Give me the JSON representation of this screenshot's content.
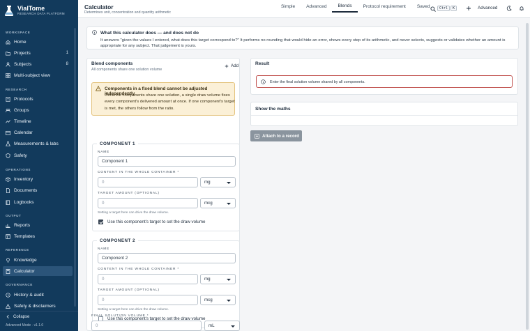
{
  "brand": {
    "name": "VialTome",
    "tagline": "RESEARCH DATA PLATFORM"
  },
  "sidebar": {
    "sections": {
      "workspace": "WORKSPACE",
      "research": "RESEARCH",
      "operations": "OPERATIONS",
      "output": "OUTPUT",
      "reference": "REFERENCE",
      "governance": "GOVERNANCE"
    },
    "items": [
      {
        "label": "Home",
        "icon": "home-icon"
      },
      {
        "label": "Projects",
        "icon": "folder-icon",
        "count": "1"
      },
      {
        "label": "Subjects",
        "icon": "subjects-icon",
        "count": "8"
      },
      {
        "label": "Multi-subject view",
        "icon": "grid-icon"
      },
      {
        "label": "Protocols",
        "icon": "protocol-icon"
      },
      {
        "label": "Groups",
        "icon": "groups-icon"
      },
      {
        "label": "Timeline",
        "icon": "timeline-icon"
      },
      {
        "label": "Calendar",
        "icon": "calendar-icon"
      },
      {
        "label": "Measurements & labs",
        "icon": "flask-icon"
      },
      {
        "label": "Safety",
        "icon": "shield-icon"
      },
      {
        "label": "Inventory",
        "icon": "box-icon"
      },
      {
        "label": "Documents",
        "icon": "document-icon"
      },
      {
        "label": "Logbooks",
        "icon": "book-icon"
      },
      {
        "label": "Reports",
        "icon": "chart-icon"
      },
      {
        "label": "Templates",
        "icon": "template-icon"
      },
      {
        "label": "Knowledge",
        "icon": "bulb-icon"
      },
      {
        "label": "Calculator",
        "icon": "calculator-icon"
      },
      {
        "label": "History & audit",
        "icon": "history-icon"
      },
      {
        "label": "Safety & disclaimers",
        "icon": "alert-icon"
      }
    ],
    "collapse_label": "Collapse",
    "version": "Advanced Mode · v1.1.0"
  },
  "header": {
    "title": "Calculator",
    "subtitle": "Determines unit, concentration and quantity arithmetic",
    "tabs": [
      "Simple",
      "Advanced",
      "Blends",
      "Protocol requirement",
      "Saved"
    ],
    "active_tab": "Blends",
    "kbd_ctrl": "Ctrl",
    "kbd_k": "K",
    "mode_label": "Advanced"
  },
  "info": {
    "title": "What this calculator does — and does not do",
    "text": "It answers \"given the values I entered, what does this target correspond to?\" It performs no rounding that would hide an error, shows every step of its arithmetic, and never selects, suggests or validates whether an amount is appropriate for any subject. That judgement is yours."
  },
  "blend": {
    "title": "Blend components",
    "subtitle": "All components share one solution volume",
    "add_label": "Add",
    "warning_title": "Components in a fixed blend cannot be adjusted independently",
    "warning_text": "Once the components share one solution, a single draw volume fixes every component's delivered amount at once. If one component's target is met, the others follow from the ratio.",
    "components": [
      {
        "legend": "COMPONENT 1",
        "name_label": "NAME",
        "name_value": "Component 1",
        "content_label": "CONTENT IN THE WHOLE CONTAINER *",
        "content_value": "0",
        "content_unit": "mg",
        "target_label": "TARGET AMOUNT (OPTIONAL)",
        "target_value": "0",
        "target_unit": "mcg",
        "hint": "Setting a target here can drive the draw volume.",
        "checkbox_label": "Use this component's target to set the draw volume",
        "checked": true
      },
      {
        "legend": "COMPONENT 2",
        "name_label": "NAME",
        "name_value": "Component 2",
        "content_label": "CONTENT IN THE WHOLE CONTAINER *",
        "content_value": "0",
        "content_unit": "mg",
        "target_label": "TARGET AMOUNT (OPTIONAL)",
        "target_value": "0",
        "target_unit": "mcg",
        "hint": "Setting a target here can drive the draw volume.",
        "checkbox_label": "Use this component's target to set the draw volume",
        "checked": false
      }
    ],
    "final_volume_label": "FINAL SOLUTION VOLUME *",
    "final_volume_value": "0",
    "final_volume_unit": "mL"
  },
  "result": {
    "title": "Result",
    "note": "Enter the final solution volume shared by all components.",
    "maths_label": "Show the maths",
    "attach_label": "Attach to a record"
  },
  "colors": {
    "sidebar_bg": "#123a5c",
    "sidebar_active": "#2b5479",
    "warning_bg": "#fbf0d7",
    "warning_border": "#e3c27b",
    "error_border": "#c0504d",
    "button_disabled": "#8a949e"
  }
}
